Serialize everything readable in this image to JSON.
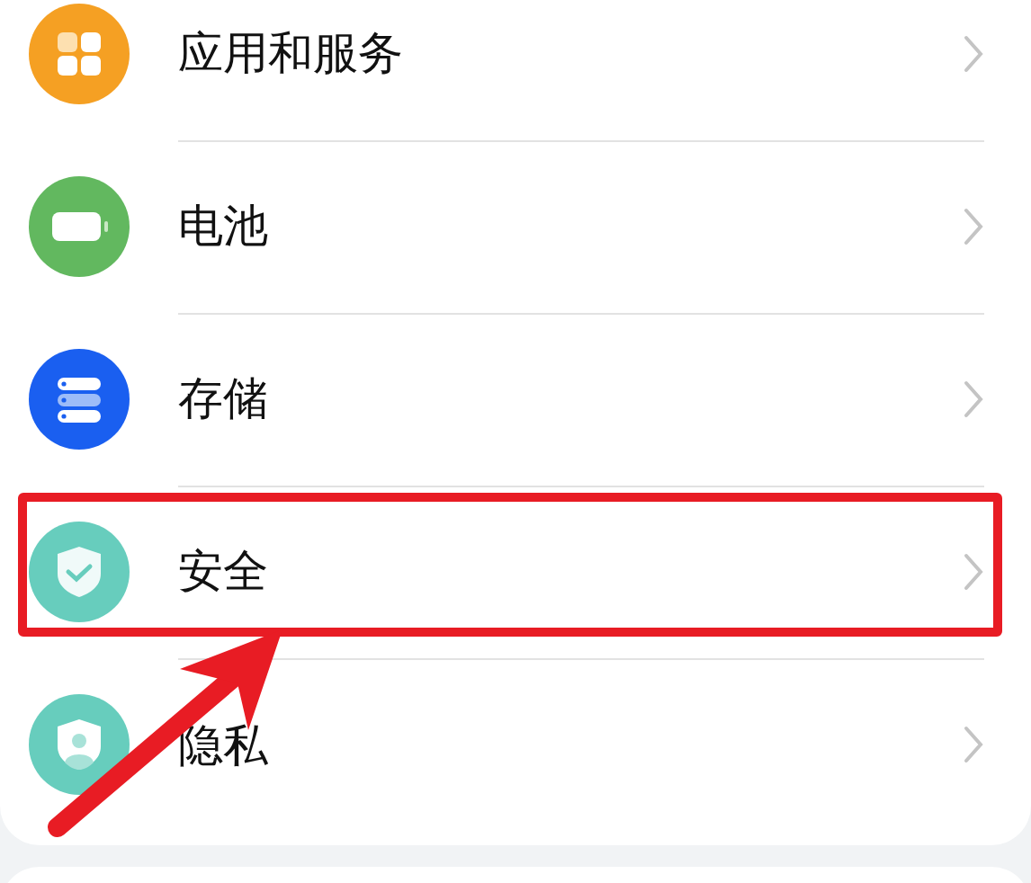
{
  "settings": [
    {
      "kind": "apps",
      "label": "应用和服务",
      "highlighted": false
    },
    {
      "kind": "battery",
      "label": "电池",
      "highlighted": false
    },
    {
      "kind": "storage",
      "label": "存储",
      "highlighted": false
    },
    {
      "kind": "security",
      "label": "安全",
      "highlighted": true
    },
    {
      "kind": "privacy",
      "label": "隐私",
      "highlighted": false
    }
  ]
}
